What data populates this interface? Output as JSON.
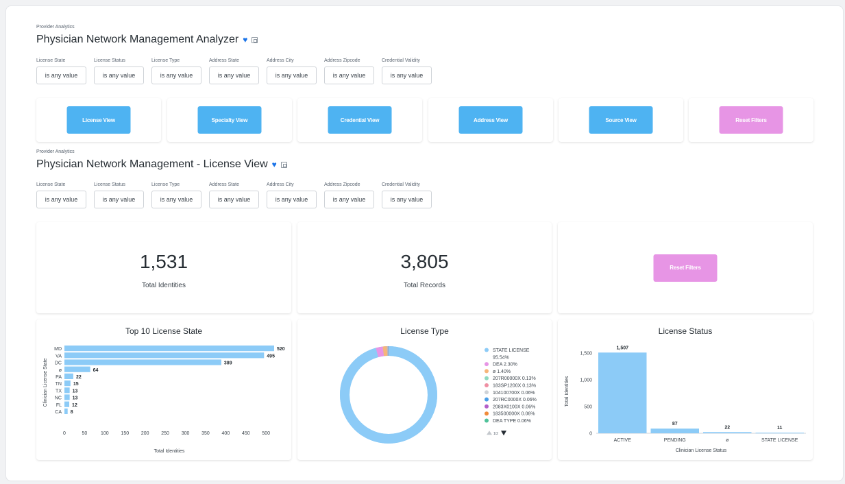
{
  "dashboard1": {
    "section_label": "Provider Analytics",
    "title": "Physician Network Management Analyzer",
    "filters": [
      {
        "label": "License State",
        "value": "is any value"
      },
      {
        "label": "License Status",
        "value": "is any value"
      },
      {
        "label": "License Type",
        "value": "is any value"
      },
      {
        "label": "Address State",
        "value": "is any value"
      },
      {
        "label": "Address City",
        "value": "is any value"
      },
      {
        "label": "Address Zipcode",
        "value": "is any value"
      },
      {
        "label": "Credential Validity",
        "value": "is any value"
      }
    ]
  },
  "nav_buttons": [
    {
      "label": "License View"
    },
    {
      "label": "Specialty View"
    },
    {
      "label": "Credential View"
    },
    {
      "label": "Address View"
    },
    {
      "label": "Source View"
    },
    {
      "label": "Reset Filters"
    }
  ],
  "dashboard2": {
    "section_label": "Provider Analytics",
    "title": "Physician Network Management - License View",
    "filters": [
      {
        "label": "License State",
        "value": "is any value"
      },
      {
        "label": "License Status",
        "value": "is any value"
      },
      {
        "label": "License Type",
        "value": "is any value"
      },
      {
        "label": "Address State",
        "value": "is any value"
      },
      {
        "label": "Address City",
        "value": "is any value"
      },
      {
        "label": "Address Zipcode",
        "value": "is any value"
      },
      {
        "label": "Credential Validity",
        "value": "is any value"
      }
    ]
  },
  "kpis": [
    {
      "value": "1,531",
      "label": "Total Identities"
    },
    {
      "value": "3,805",
      "label": "Total Records"
    }
  ],
  "reset_filters_label": "Reset Filters",
  "colors": {
    "button_blue": "#4eb3f2",
    "button_pink": "#e795e5",
    "bar_blue": "#8ccbf7",
    "heart": "#1a73e8"
  },
  "icons": [
    "heart-icon",
    "copy-icon",
    "triangle-up-icon",
    "triangle-down-icon"
  ],
  "legend_pager": "1/2",
  "chart_data": [
    {
      "type": "bar",
      "orientation": "horizontal",
      "title": "Top 10 License State",
      "xlabel": "Total Identities",
      "ylabel": "Clinician License State",
      "categories": [
        "MD",
        "VA",
        "DC",
        "ø",
        "PA",
        "TN",
        "TX",
        "NC",
        "FL",
        "CA"
      ],
      "values": [
        520,
        495,
        389,
        64,
        22,
        15,
        13,
        13,
        12,
        8
      ],
      "xlim": [
        0,
        520
      ],
      "xticks": [
        0,
        50,
        100,
        150,
        200,
        250,
        300,
        350,
        400,
        450,
        500
      ]
    },
    {
      "type": "pie",
      "title": "License Type",
      "donut": true,
      "labels": [
        "STATE LICENSE",
        "DEA",
        "ø",
        "207R00000X",
        "183SP1200X",
        "104100700X",
        "207RC0000X",
        "2083X0100X",
        "183500000X",
        "DEA TYPE"
      ],
      "values": [
        95.54,
        2.3,
        1.4,
        0.13,
        0.13,
        0.06,
        0.06,
        0.06,
        0.06,
        0.06
      ],
      "legend_text": [
        "STATE LICENSE",
        "95.54%",
        "DEA 2.30%",
        "ø 1.40%",
        "207R00000X 0.13%",
        "183SP1200X 0.13%",
        "104100700X 0.06%",
        "207RC0000X 0.06%",
        "2083X0100X 0.06%",
        "183500000X 0.06%",
        "DEA TYPE 0.06%"
      ],
      "colors": [
        "#8ccbf7",
        "#e795e5",
        "#f6b57a",
        "#8fd9c0",
        "#ef8fa3",
        "#cfd3d8",
        "#4a9ee8",
        "#b35fc9",
        "#f08b3a",
        "#4fc29a"
      ]
    },
    {
      "type": "bar",
      "title": "License Status",
      "xlabel": "Clinician License Status",
      "ylabel": "Total Identities",
      "categories": [
        "ACTIVE",
        "PENDING",
        "ø",
        "STATE LICENSE"
      ],
      "values": [
        1507,
        87,
        22,
        11
      ],
      "value_labels": [
        "1,507",
        "87",
        "22",
        "11"
      ],
      "ylim": [
        0,
        1600
      ],
      "yticks": [
        0,
        500,
        1000,
        1500
      ],
      "ytick_labels": [
        "0",
        "500",
        "1,000",
        "1,500"
      ]
    }
  ]
}
